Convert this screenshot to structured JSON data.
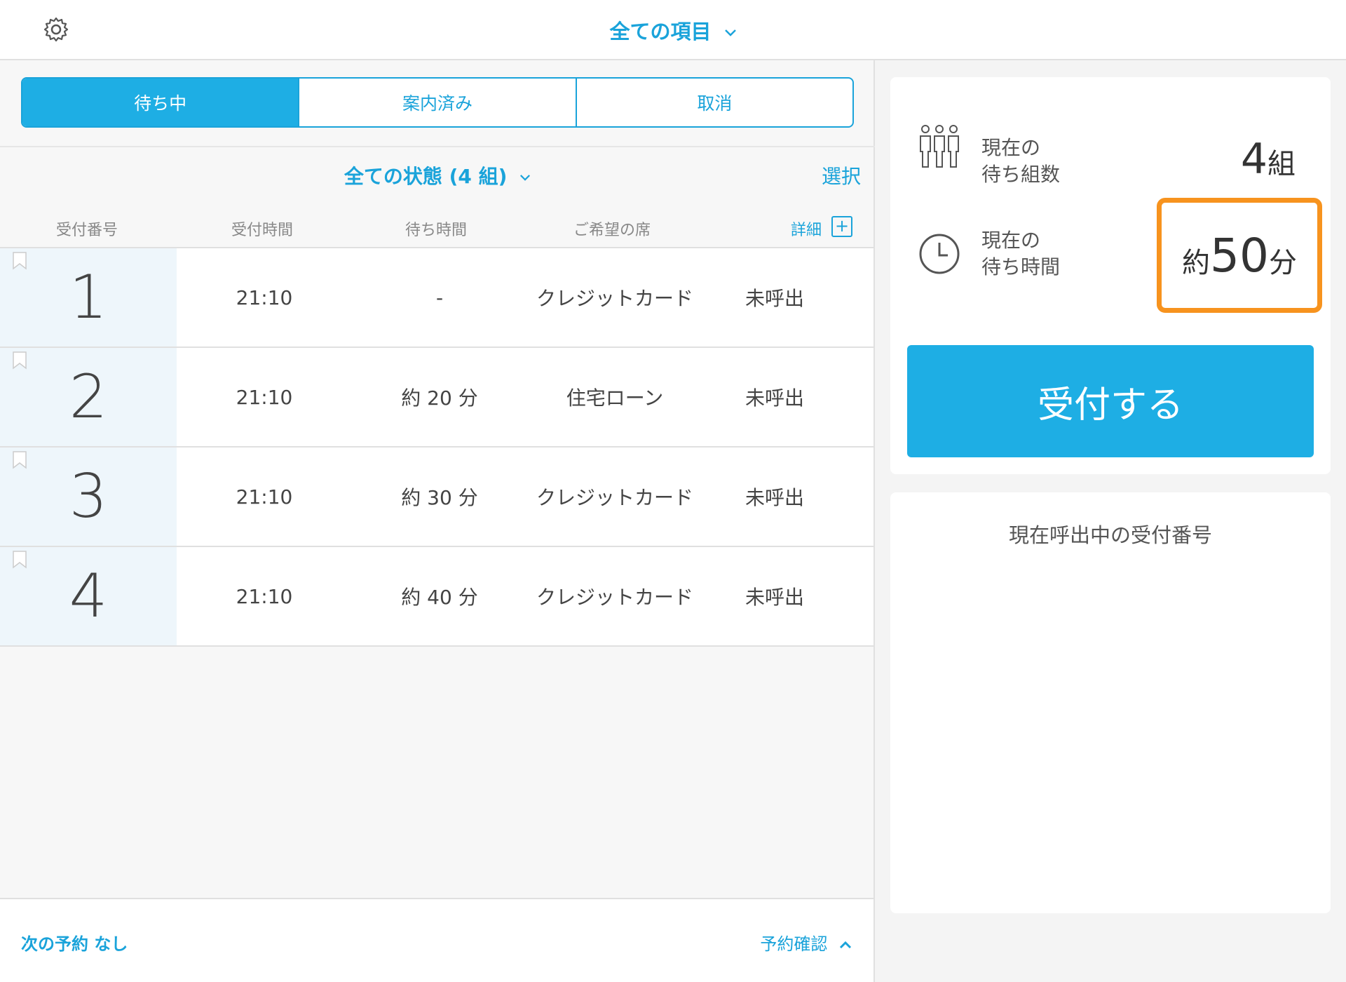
{
  "header": {
    "title": "全ての項目",
    "icon": "gear-icon"
  },
  "tabs": [
    {
      "label": "待ち中",
      "active": true
    },
    {
      "label": "案内済み",
      "active": false
    },
    {
      "label": "取消",
      "active": false
    }
  ],
  "filter": {
    "label": "全ての状態 (4 組)",
    "select_label": "選択"
  },
  "columns": {
    "number": "受付番号",
    "time": "受付時間",
    "wait": "待ち時間",
    "seat": "ご希望の席",
    "detail": "詳細"
  },
  "rows": [
    {
      "number": "1",
      "time": "21:10",
      "wait": "-",
      "seat": "クレジットカード",
      "status": "未呼出"
    },
    {
      "number": "2",
      "time": "21:10",
      "wait": "約 20 分",
      "seat": "住宅ローン",
      "status": "未呼出"
    },
    {
      "number": "3",
      "time": "21:10",
      "wait": "約 30 分",
      "seat": "クレジットカード",
      "status": "未呼出"
    },
    {
      "number": "4",
      "time": "21:10",
      "wait": "約 40 分",
      "seat": "クレジットカード",
      "status": "未呼出"
    }
  ],
  "footer": {
    "next_reservation": "次の予約 なし",
    "confirm_label": "予約確認"
  },
  "stats": {
    "groups_label_1": "現在の",
    "groups_label_2": "待ち組数",
    "groups_value": "4",
    "groups_unit": "組",
    "time_label_1": "現在の",
    "time_label_2": "待ち時間",
    "time_prefix": "約",
    "time_value": "50",
    "time_unit": "分"
  },
  "accept_button": "受付する",
  "current_call_title": "現在呼出中の受付番号",
  "colors": {
    "accent": "#1eaee4",
    "highlight": "#f7931e"
  }
}
